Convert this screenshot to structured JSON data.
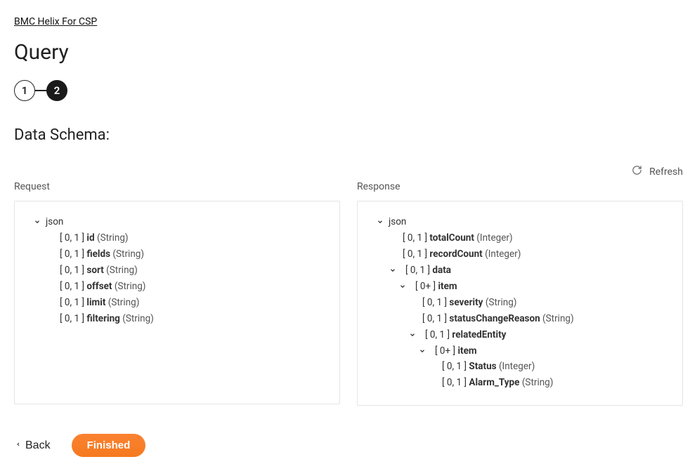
{
  "breadcrumb": {
    "label": "BMC Helix For CSP"
  },
  "page": {
    "title": "Query"
  },
  "stepper": {
    "steps": [
      "1",
      "2"
    ],
    "active": 1
  },
  "section": {
    "title": "Data Schema:"
  },
  "refresh": {
    "label": "Refresh"
  },
  "columns": {
    "request": {
      "label": "Request"
    },
    "response": {
      "label": "Response"
    }
  },
  "tree": {
    "root": "json",
    "request": [
      {
        "card": "[ 0, 1 ]",
        "name": "id",
        "type": "(String)"
      },
      {
        "card": "[ 0, 1 ]",
        "name": "fields",
        "type": "(String)"
      },
      {
        "card": "[ 0, 1 ]",
        "name": "sort",
        "type": "(String)"
      },
      {
        "card": "[ 0, 1 ]",
        "name": "offset",
        "type": "(String)"
      },
      {
        "card": "[ 0, 1 ]",
        "name": "limit",
        "type": "(String)"
      },
      {
        "card": "[ 0, 1 ]",
        "name": "filtering",
        "type": "(String)"
      }
    ],
    "response": {
      "totalCount": {
        "card": "[ 0, 1 ]",
        "name": "totalCount",
        "type": "(Integer)"
      },
      "recordCount": {
        "card": "[ 0, 1 ]",
        "name": "recordCount",
        "type": "(Integer)"
      },
      "data": {
        "card": "[ 0, 1 ]",
        "name": "data"
      },
      "item1": {
        "card": "[ 0+ ]",
        "name": "item"
      },
      "severity": {
        "card": "[ 0, 1 ]",
        "name": "severity",
        "type": "(String)"
      },
      "statusChangeReason": {
        "card": "[ 0, 1 ]",
        "name": "statusChangeReason",
        "type": "(String)"
      },
      "relatedEntity": {
        "card": "[ 0, 1 ]",
        "name": "relatedEntity"
      },
      "item2": {
        "card": "[ 0+ ]",
        "name": "item"
      },
      "Status": {
        "card": "[ 0, 1 ]",
        "name": "Status",
        "type": "(Integer)"
      },
      "Alarm_Type": {
        "card": "[ 0, 1 ]",
        "name": "Alarm_Type",
        "type": "(String)"
      }
    }
  },
  "footer": {
    "back": "Back",
    "finished": "Finished"
  }
}
